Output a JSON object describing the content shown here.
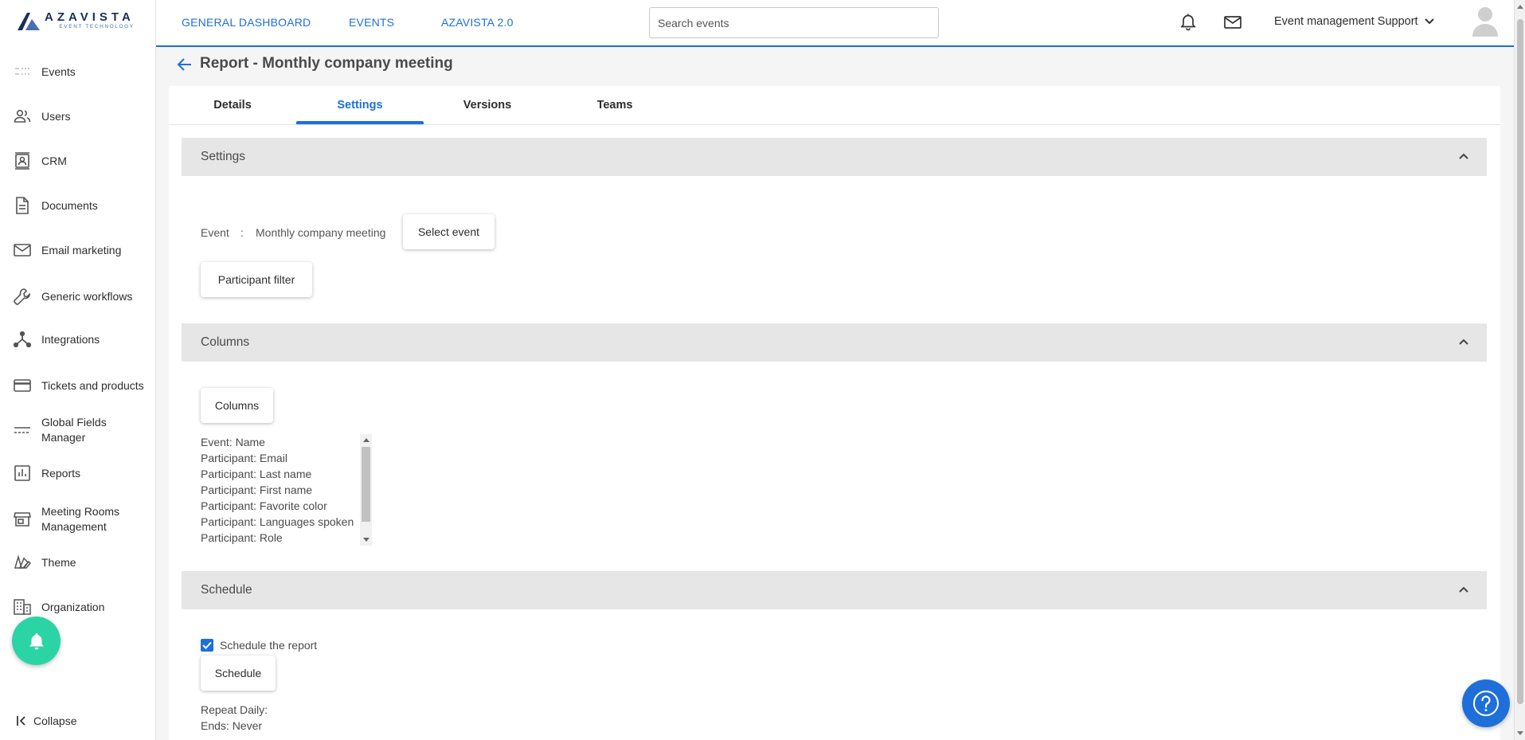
{
  "brand": {
    "name": "AZAVISTA",
    "tagline": "EVENT TECHNOLOGY",
    "accent": "#1e6fd9",
    "fab_color": "#2bd4a4"
  },
  "sidebar": {
    "items": [
      {
        "label": "Events",
        "icon": "events-icon"
      },
      {
        "label": "Users",
        "icon": "users-icon"
      },
      {
        "label": "CRM",
        "icon": "crm-icon"
      },
      {
        "label": "Documents",
        "icon": "documents-icon"
      },
      {
        "label": "Email marketing",
        "icon": "email-icon"
      },
      {
        "label": "Generic workflows",
        "icon": "wrench-icon"
      },
      {
        "label": "Integrations",
        "icon": "integrations-icon"
      },
      {
        "label": "Tickets and products",
        "icon": "card-icon"
      },
      {
        "label": "Global Fields Manager",
        "icon": "fields-icon"
      },
      {
        "label": "Reports",
        "icon": "reports-icon"
      },
      {
        "label": "Meeting Rooms Management",
        "icon": "store-icon"
      },
      {
        "label": "Theme",
        "icon": "theme-icon"
      },
      {
        "label": "Organization",
        "icon": "organization-icon"
      }
    ],
    "collapse_label": "Collapse"
  },
  "topbar": {
    "nav": [
      "GENERAL DASHBOARD",
      "EVENTS",
      "AZAVISTA 2.0"
    ],
    "search_placeholder": "Search events",
    "user_label": "Event management Support"
  },
  "page": {
    "title": "Report - Monthly company meeting",
    "tabs": [
      "Details",
      "Settings",
      "Versions",
      "Teams"
    ],
    "active_tab": "Settings"
  },
  "settings_section": {
    "title": "Settings",
    "event_label": "Event",
    "separator": ":",
    "event_value": "Monthly company meeting",
    "select_event_button": "Select event",
    "participant_filter_button": "Participant filter"
  },
  "columns_section": {
    "title": "Columns",
    "columns_button": "Columns",
    "items": [
      "Event: Name",
      "Participant: Email",
      "Participant: Last name",
      "Participant: First name",
      "Participant: Favorite color",
      "Participant: Languages spoken",
      "Participant: Role"
    ]
  },
  "schedule_section": {
    "title": "Schedule",
    "checkbox_label": "Schedule the report",
    "checked": true,
    "schedule_button": "Schedule",
    "repeat_text": "Repeat Daily:",
    "ends_text": "Ends: Never"
  }
}
